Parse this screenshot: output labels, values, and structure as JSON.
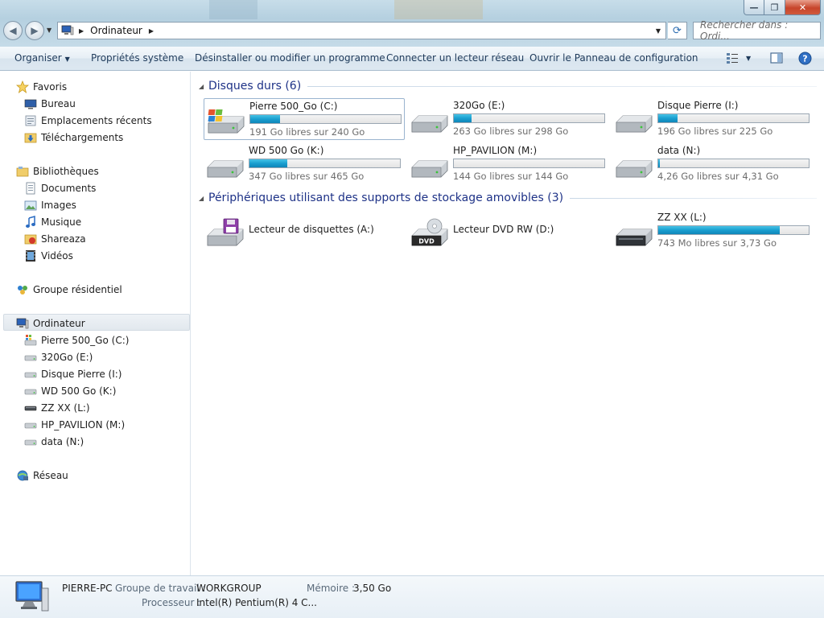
{
  "window": {
    "minimize_glyph": "—",
    "maximize_glyph": "❐",
    "close_glyph": "✕"
  },
  "address": {
    "crumb": "Ordinateur",
    "search_placeholder": "Rechercher dans : Ordi..."
  },
  "toolbar": {
    "organize": "Organiser",
    "system_properties": "Propriétés système",
    "uninstall": "Désinstaller ou modifier un programme",
    "map_drive": "Connecter un lecteur réseau",
    "control_panel": "Ouvrir le Panneau de configuration",
    "help_glyph": "?"
  },
  "sidebar": {
    "favorites": "Favoris",
    "favorites_items": [
      "Bureau",
      "Emplacements récents",
      "Téléchargements"
    ],
    "libraries": "Bibliothèques",
    "libraries_items": [
      "Documents",
      "Images",
      "Musique",
      "Shareaza",
      "Vidéos"
    ],
    "homegroup": "Groupe résidentiel",
    "computer": "Ordinateur",
    "computer_items": [
      "Pierre 500_Go (C:)",
      "320Go (E:)",
      "Disque Pierre (I:)",
      "WD 500 Go (K:)",
      "ZZ XX (L:)",
      "HP_PAVILION (M:)",
      "data (N:)"
    ],
    "network": "Réseau"
  },
  "groups": {
    "hard_disks": "Disques durs (6)",
    "removable": "Périphériques utilisant des supports de stockage amovibles (3)"
  },
  "hard_disks": [
    {
      "name": "Pierre 500_Go (C:)",
      "free": "191 Go libres sur 240 Go",
      "used_fraction": 0.2,
      "icon": "windows-drive-icon"
    },
    {
      "name": "320Go (E:)",
      "free": "263 Go libres sur 298 Go",
      "used_fraction": 0.12,
      "icon": "hard-drive-icon"
    },
    {
      "name": "Disque Pierre (I:)",
      "free": "196 Go libres sur 225 Go",
      "used_fraction": 0.13,
      "icon": "hard-drive-icon"
    },
    {
      "name": "WD 500 Go (K:)",
      "free": "347 Go libres sur 465 Go",
      "used_fraction": 0.25,
      "icon": "hard-drive-icon"
    },
    {
      "name": "HP_PAVILION (M:)",
      "free": "144 Go libres sur 144 Go",
      "used_fraction": 0.0,
      "icon": "hard-drive-icon"
    },
    {
      "name": "data (N:)",
      "free": "4,26 Go libres sur 4,31 Go",
      "used_fraction": 0.01,
      "icon": "hard-drive-icon"
    }
  ],
  "removable": [
    {
      "name": "Lecteur de disquettes (A:)",
      "icon": "floppy-drive-icon"
    },
    {
      "name": "Lecteur DVD RW (D:)",
      "icon": "dvd-drive-icon",
      "badge": "DVD"
    },
    {
      "name": "ZZ XX (L:)",
      "free": "743 Mo libres sur 3,73 Go",
      "used_fraction": 0.81,
      "icon": "removable-drive-icon"
    }
  ],
  "details": {
    "computer_name": "PIERRE-PC",
    "workgroup_label": "Groupe de travail :",
    "workgroup": "WORKGROUP",
    "memory_label": "Mémoire :",
    "memory": "3,50 Go",
    "processor_label": "Processeur :",
    "processor": "Intel(R) Pentium(R) 4 C..."
  },
  "colors": {
    "group_header": "#1e3287",
    "bar_fill": "#1a9fd0",
    "command_text": "#1e3a5a"
  }
}
